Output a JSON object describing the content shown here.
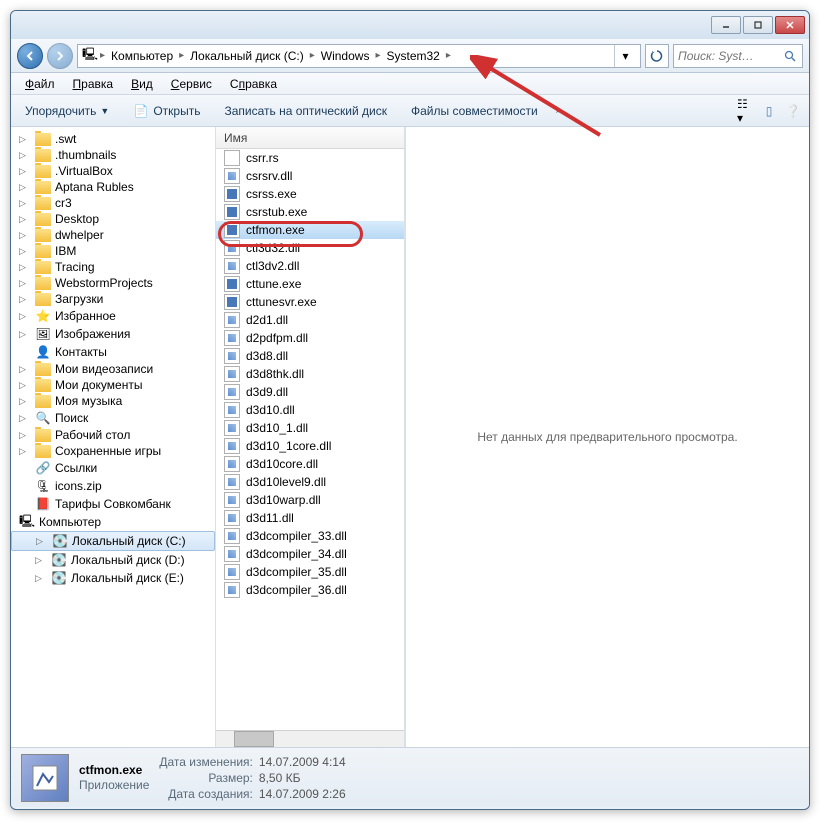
{
  "breadcrumb": [
    "Компьютер",
    "Локальный диск (C:)",
    "Windows",
    "System32"
  ],
  "search": {
    "placeholder": "Поиск: Syst…"
  },
  "menubar": [
    {
      "label": "Файл",
      "u": 0
    },
    {
      "label": "Правка",
      "u": 0
    },
    {
      "label": "Вид",
      "u": 0
    },
    {
      "label": "Сервис",
      "u": 0
    },
    {
      "label": "Справка",
      "u": 1
    }
  ],
  "toolbar": {
    "organize": "Упорядочить",
    "open": "Открыть",
    "burn": "Записать на оптический диск",
    "compat": "Файлы совместимости"
  },
  "sidebar": [
    {
      "label": ".swt",
      "type": "folder",
      "expandable": true
    },
    {
      "label": ".thumbnails",
      "type": "folder",
      "expandable": true
    },
    {
      "label": ".VirtualBox",
      "type": "folder",
      "expandable": true
    },
    {
      "label": "Aptana Rubles",
      "type": "folder",
      "expandable": true
    },
    {
      "label": "cr3",
      "type": "folder",
      "expandable": true
    },
    {
      "label": "Desktop",
      "type": "folder",
      "expandable": true
    },
    {
      "label": "dwhelper",
      "type": "folder",
      "expandable": true
    },
    {
      "label": "IBM",
      "type": "folder",
      "expandable": true
    },
    {
      "label": "Tracing",
      "type": "folder",
      "expandable": true
    },
    {
      "label": "WebstormProjects",
      "type": "folder",
      "expandable": true
    },
    {
      "label": "Загрузки",
      "type": "folder",
      "expandable": true
    },
    {
      "label": "Избранное",
      "type": "star",
      "expandable": true
    },
    {
      "label": "Изображения",
      "type": "pictures",
      "expandable": true
    },
    {
      "label": "Контакты",
      "type": "contacts",
      "expandable": false
    },
    {
      "label": "Мои видеозаписи",
      "type": "folder",
      "expandable": true
    },
    {
      "label": "Мои документы",
      "type": "folder",
      "expandable": true
    },
    {
      "label": "Моя музыка",
      "type": "folder",
      "expandable": true
    },
    {
      "label": "Поиск",
      "type": "search",
      "expandable": true
    },
    {
      "label": "Рабочий стол",
      "type": "folder",
      "expandable": true
    },
    {
      "label": "Сохраненные игры",
      "type": "folder",
      "expandable": true
    },
    {
      "label": "Ссылки",
      "type": "links",
      "expandable": false
    },
    {
      "label": "icons.zip",
      "type": "zip",
      "expandable": false
    },
    {
      "label": "Тарифы Совкомбанк",
      "type": "pdf",
      "expandable": false
    },
    {
      "label": "Компьютер",
      "type": "computer",
      "expandable": true,
      "level": 0
    },
    {
      "label": "Локальный диск (C:)",
      "type": "drive",
      "expandable": true,
      "level": 1,
      "selected": true
    },
    {
      "label": "Локальный диск (D:)",
      "type": "drive",
      "expandable": true,
      "level": 1
    },
    {
      "label": "Локальный диск (E:)",
      "type": "drive",
      "expandable": true,
      "level": 1
    }
  ],
  "filelist": {
    "column": "Имя",
    "files": [
      {
        "name": "csrr.rs",
        "type": "file"
      },
      {
        "name": "csrsrv.dll",
        "type": "dll"
      },
      {
        "name": "csrss.exe",
        "type": "exe"
      },
      {
        "name": "csrstub.exe",
        "type": "exe"
      },
      {
        "name": "ctfmon.exe",
        "type": "exe",
        "selected": true,
        "highlighted": true
      },
      {
        "name": "ctl3d32.dll",
        "type": "dll"
      },
      {
        "name": "ctl3dv2.dll",
        "type": "dll"
      },
      {
        "name": "cttune.exe",
        "type": "exe"
      },
      {
        "name": "cttunesvr.exe",
        "type": "exe"
      },
      {
        "name": "d2d1.dll",
        "type": "dll"
      },
      {
        "name": "d2pdfpm.dll",
        "type": "dll"
      },
      {
        "name": "d3d8.dll",
        "type": "dll"
      },
      {
        "name": "d3d8thk.dll",
        "type": "dll"
      },
      {
        "name": "d3d9.dll",
        "type": "dll"
      },
      {
        "name": "d3d10.dll",
        "type": "dll"
      },
      {
        "name": "d3d10_1.dll",
        "type": "dll"
      },
      {
        "name": "d3d10_1core.dll",
        "type": "dll"
      },
      {
        "name": "d3d10core.dll",
        "type": "dll"
      },
      {
        "name": "d3d10level9.dll",
        "type": "dll"
      },
      {
        "name": "d3d10warp.dll",
        "type": "dll"
      },
      {
        "name": "d3d11.dll",
        "type": "dll"
      },
      {
        "name": "d3dcompiler_33.dll",
        "type": "dll"
      },
      {
        "name": "d3dcompiler_34.dll",
        "type": "dll"
      },
      {
        "name": "d3dcompiler_35.dll",
        "type": "dll"
      },
      {
        "name": "d3dcompiler_36.dll",
        "type": "dll"
      }
    ]
  },
  "preview": {
    "empty": "Нет данных для предварительного просмотра."
  },
  "status": {
    "filename": "ctfmon.exe",
    "filetype": "Приложение",
    "modified_label": "Дата изменения:",
    "modified": "14.07.2009 4:14",
    "size_label": "Размер:",
    "size": "8,50 КБ",
    "created_label": "Дата создания:",
    "created": "14.07.2009 2:26"
  }
}
